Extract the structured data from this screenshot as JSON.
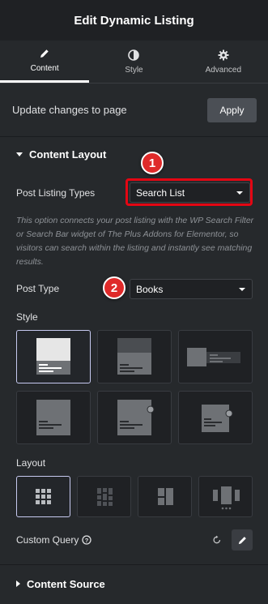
{
  "header": {
    "title": "Edit Dynamic Listing"
  },
  "tabs": [
    {
      "label": "Content",
      "icon": "pencil-icon",
      "active": true
    },
    {
      "label": "Style",
      "icon": "half-circle-icon",
      "active": false
    },
    {
      "label": "Advanced",
      "icon": "gear-icon",
      "active": false
    }
  ],
  "update": {
    "label": "Update changes to page",
    "apply_label": "Apply"
  },
  "content_layout": {
    "title": "Content Layout",
    "post_listing_types": {
      "label": "Post Listing Types",
      "value": "Search List"
    },
    "description": "This option connects your post listing with the WP Search Filter or Search Bar widget of The Plus Addons for Elementor, so visitors can search within the listing and instantly see matching results.",
    "post_type": {
      "label": "Post Type",
      "value": "Books"
    },
    "style": {
      "label": "Style",
      "selected_index": 0,
      "count": 6
    },
    "layout": {
      "label": "Layout",
      "selected_index": 0,
      "count": 4
    },
    "custom_query": {
      "label": "Custom Query"
    }
  },
  "content_source": {
    "title": "Content Source"
  },
  "annotations": {
    "badge1": "1",
    "badge2": "2"
  },
  "colors": {
    "highlight": "#e40613",
    "badge": "#df2a2a",
    "selected_border": "#c6c9f0"
  }
}
